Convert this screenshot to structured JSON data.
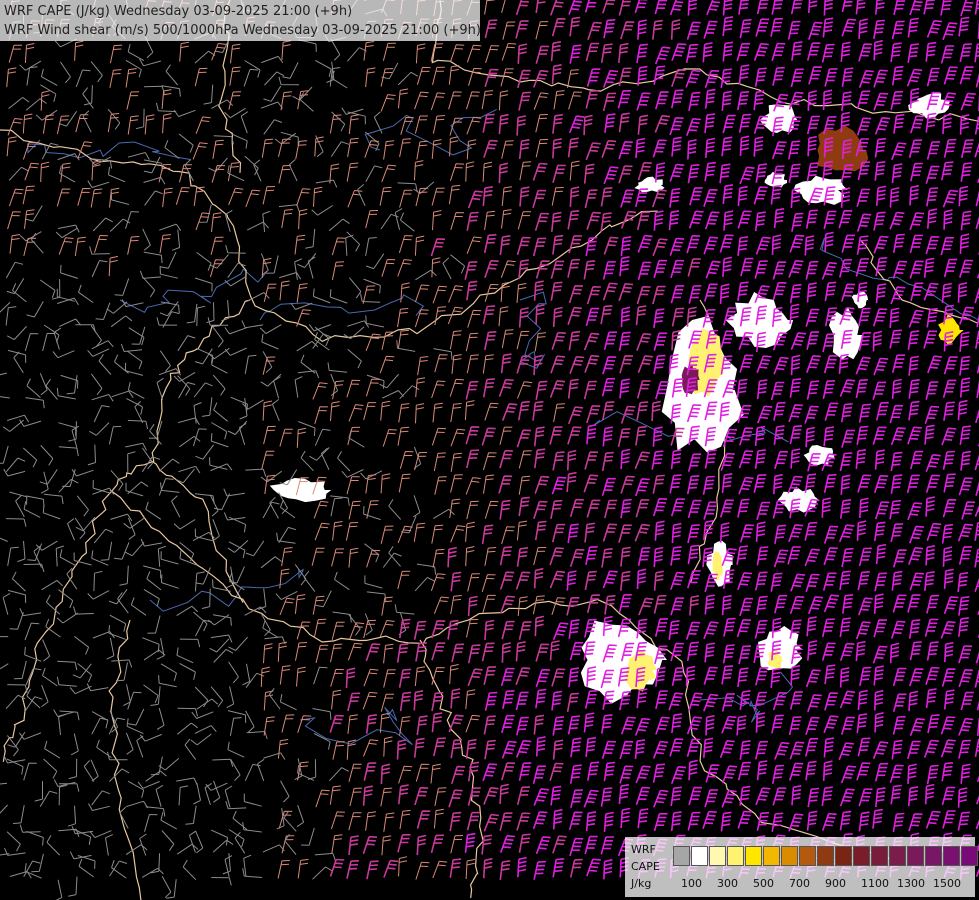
{
  "title": {
    "line1": "WRF CAPE (J/kg) Wednesday 03-09-2025 21:00 (+9h)",
    "line2": "WRF Wind shear (m/s) 500/1000hPa Wednesday 03-09-2025 21:00 (+9h)"
  },
  "legend": {
    "label_line1": "WRF",
    "label_line2": "CAPE",
    "label_line3": "J/kg",
    "ticks": [
      "100",
      "300",
      "500",
      "700",
      "900",
      "1100",
      "1300",
      "1500"
    ],
    "colors": [
      "#a6a6a6",
      "#ffffff",
      "#fff8b0",
      "#fff270",
      "#ffe600",
      "#f2b700",
      "#d98c00",
      "#b35a10",
      "#8f3b12",
      "#7a2415",
      "#7a1d2a",
      "#7a1d3a",
      "#7a1d4a",
      "#7a1a5a",
      "#7a1666",
      "#7a1070",
      "#7a0a78"
    ]
  },
  "map": {
    "background_color": "#000000",
    "barb_colors": {
      "weak": "#8c8c8c",
      "moderate": "#d98a7a",
      "strong": "#c83a9a",
      "very_strong": "#e020e0"
    },
    "border_color": "#e8c8a0",
    "river_color": "#4a6ab0"
  }
}
